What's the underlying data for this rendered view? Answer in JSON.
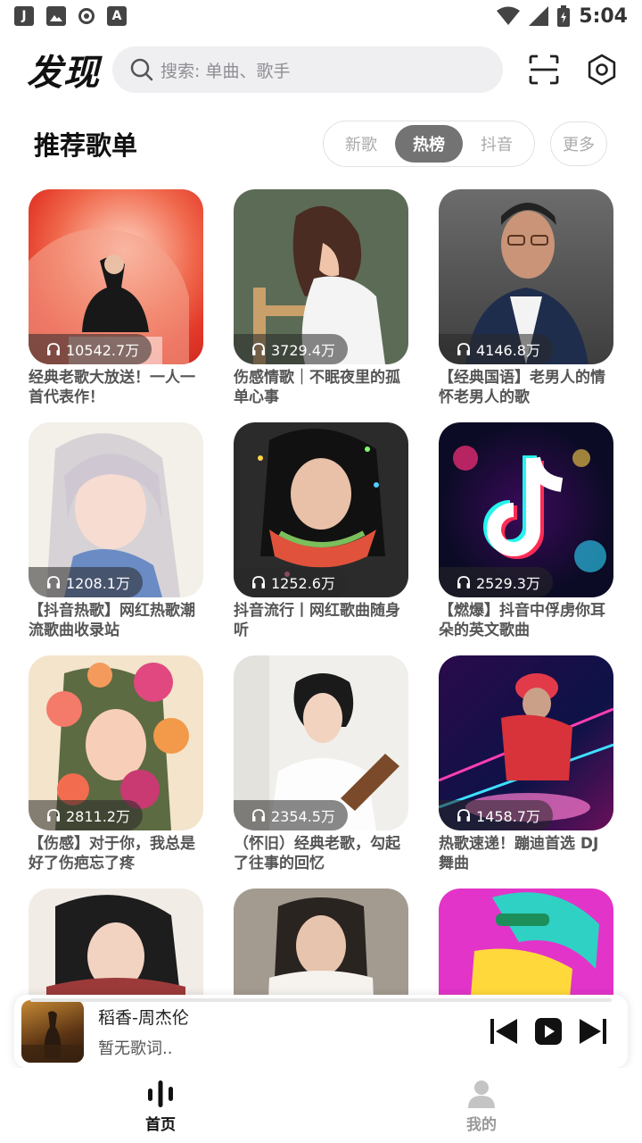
{
  "status_bar": {
    "time": "5:04",
    "left_icons": [
      "J",
      "image-icon",
      "record-icon",
      "A"
    ]
  },
  "header": {
    "title": "发现",
    "search_placeholder": "搜索: 单曲、歌手"
  },
  "section": {
    "title": "推荐歌单",
    "tabs": [
      {
        "label": "新歌",
        "active": false
      },
      {
        "label": "热榜",
        "active": true
      },
      {
        "label": "抖音",
        "active": false
      }
    ],
    "more_label": "更多"
  },
  "playlists": [
    {
      "count": "10542.7万",
      "title": "经典老歌大放送！一人一首代表作！"
    },
    {
      "count": "3729.4万",
      "title": "伤感情歌｜不眠夜里的孤单心事"
    },
    {
      "count": "4146.8万",
      "title": "【经典国语】老男人的情怀老男人的歌"
    },
    {
      "count": "1208.1万",
      "title": "【抖音热歌】网红热歌潮流歌曲收录站"
    },
    {
      "count": "1252.6万",
      "title": "抖音流行丨网红歌曲随身听"
    },
    {
      "count": "2529.3万",
      "title": "【燃爆】抖音中俘虏你耳朵的英文歌曲"
    },
    {
      "count": "2811.2万",
      "title": "【伤感】对于你，我总是好了伤疤忘了疼"
    },
    {
      "count": "2354.5万",
      "title": "（怀旧）经典老歌，勾起了往事的回忆"
    },
    {
      "count": "1458.7万",
      "title": "热歌速递！蹦迪首选 DJ舞曲"
    },
    {
      "count": "",
      "title": ""
    },
    {
      "count": "",
      "title": ""
    },
    {
      "count": "",
      "title": ""
    }
  ],
  "player": {
    "song": "稻香-周杰伦",
    "lyric": "暂无歌词.."
  },
  "nav": {
    "home_label": "首页",
    "mine_label": "我的"
  },
  "colors": {
    "active_tab": "#737373",
    "search_bg": "#efeff2"
  }
}
